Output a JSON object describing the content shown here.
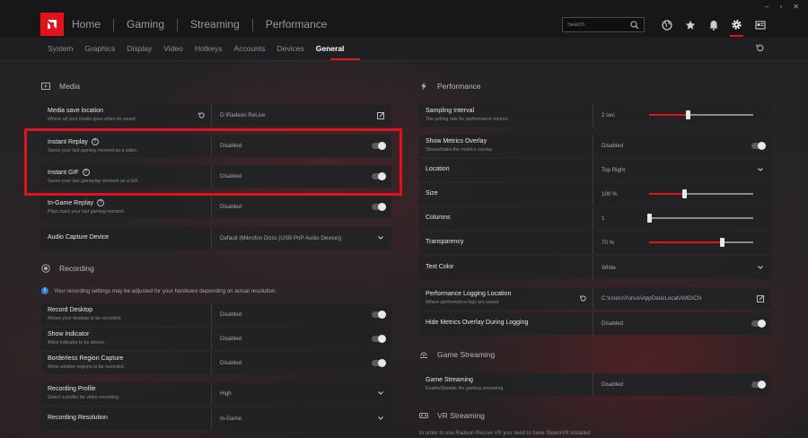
{
  "topnav": {
    "items": [
      "Home",
      "Gaming",
      "Streaming",
      "Performance"
    ],
    "search_placeholder": "Search"
  },
  "window_controls": [
    "–",
    "▫",
    "✕"
  ],
  "subtabs": [
    "System",
    "Graphics",
    "Display",
    "Video",
    "Hotkeys",
    "Accounts",
    "Devices",
    "General"
  ],
  "active_subtab": "General",
  "media": {
    "title": "Media",
    "rows": [
      {
        "label": "Media save location",
        "desc": "Where all your media goes when its saved.",
        "value": "D:\\Radeon ReLive"
      },
      {
        "label": "Instant Replay",
        "desc": "Saves your last gaming moment as a video.",
        "value": "Disabled"
      },
      {
        "label": "Instant GIF",
        "desc": "Saves your last gameplay moment as a GIF.",
        "value": "Disabled"
      },
      {
        "label": "In-Game Replay",
        "desc": "Plays back your last gaming moment.",
        "value": "Disabled"
      },
      {
        "label": "Audio Capture Device",
        "desc": "",
        "value": "Default (Mikrofon Dizisi (USB PnP Audio Device))"
      }
    ]
  },
  "recording": {
    "title": "Recording",
    "note": "Your recording settings may be adjusted for your hardware depending on actual resolution.",
    "rows": [
      {
        "label": "Record Desktop",
        "desc": "Allows your desktop to be recorded.",
        "value": "Disabled"
      },
      {
        "label": "Show Indicator",
        "desc": "Allow indicator to be shown.",
        "value": "Disabled"
      },
      {
        "label": "Borderless Region Capture",
        "desc": "Allow window regions to be recorded.",
        "value": "Disabled"
      },
      {
        "label": "Recording Profile",
        "desc": "Select a profile for video recording.",
        "value": "High"
      },
      {
        "label": "Recording Resolution",
        "desc": "",
        "value": "In-Game"
      }
    ]
  },
  "performance": {
    "title": "Performance",
    "rows": [
      {
        "label": "Sampling Interval",
        "desc": "The polling rate for performance metrics",
        "value": "2 sec",
        "level": 0.37
      },
      {
        "label": "Show Metrics Overlay",
        "desc": "Shows/hides the metrics overlay",
        "value": "Disabled"
      },
      {
        "label": "Location",
        "desc": "",
        "value": "Top Right"
      },
      {
        "label": "Size",
        "desc": "",
        "value": "100 %",
        "level": 0.34
      },
      {
        "label": "Columns",
        "desc": "",
        "value": "1",
        "level": 0.0
      },
      {
        "label": "Transparency",
        "desc": "",
        "value": "70 %",
        "level": 0.7
      },
      {
        "label": "Text Color",
        "desc": "",
        "value": "White"
      },
      {
        "label": "Performance Logging Location",
        "desc": "Where performance logs are saved.",
        "value": "C:\\Users\\Yunus\\AppData\\Local\\AMD\\CN"
      },
      {
        "label": "Hide Metrics Overlay During Logging",
        "desc": "",
        "value": "Disabled"
      }
    ]
  },
  "game_streaming": {
    "title": "Game Streaming",
    "rows": [
      {
        "label": "Game Streaming",
        "desc": "Enable/Disable the gaming streaming",
        "value": "Disabled"
      }
    ]
  },
  "vr_streaming": {
    "title": "VR Streaming",
    "note": "In order to use Radeon ReLive VR you need to have SteamVR installed"
  },
  "colors": {
    "accent": "#e3131b",
    "highlight_box": "#e0121a"
  }
}
